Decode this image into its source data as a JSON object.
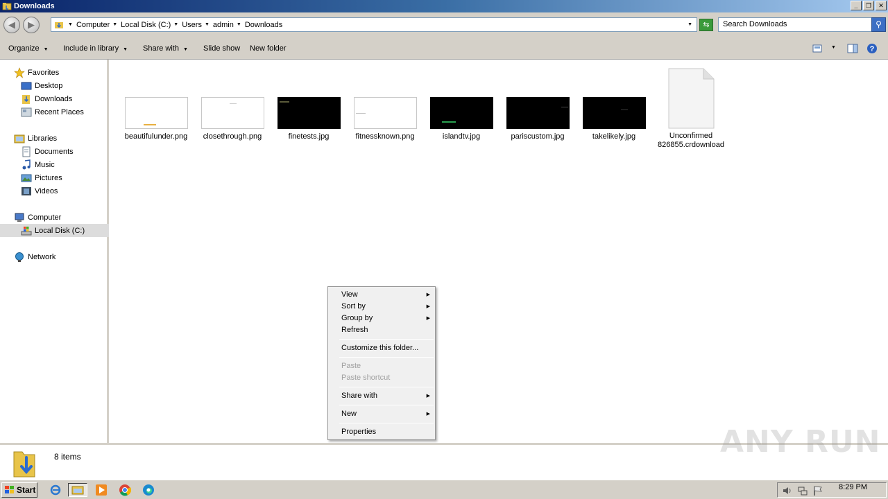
{
  "window": {
    "title": "Downloads",
    "buttons": [
      "minimize",
      "restore",
      "close"
    ]
  },
  "address": {
    "crumbs": [
      "Computer",
      "Local Disk (C:)",
      "Users",
      "admin",
      "Downloads"
    ],
    "search_placeholder": "Search Downloads"
  },
  "toolbar": {
    "organize": "Organize",
    "include_in_library": "Include in library",
    "share_with": "Share with",
    "slide_show": "Slide show",
    "new_folder": "New folder"
  },
  "nav": {
    "favorites": "Favorites",
    "desktop": "Desktop",
    "downloads": "Downloads",
    "recent_places": "Recent Places",
    "libraries": "Libraries",
    "documents": "Documents",
    "music": "Music",
    "pictures": "Pictures",
    "videos": "Videos",
    "computer": "Computer",
    "local_disk": "Local Disk (C:)",
    "network": "Network"
  },
  "files": [
    {
      "name": "beautifulunder.png",
      "thumb": "light"
    },
    {
      "name": "closethrough.png",
      "thumb": "light"
    },
    {
      "name": "finetests.jpg",
      "thumb": "dark"
    },
    {
      "name": "fitnessknown.png",
      "thumb": "light"
    },
    {
      "name": "islandtv.jpg",
      "thumb": "dark"
    },
    {
      "name": "pariscustom.jpg",
      "thumb": "dark"
    },
    {
      "name": "takelikely.jpg",
      "thumb": "dark"
    },
    {
      "name_line1": "Unconfirmed",
      "name_line2": "826855.crdownload",
      "thumb": "document"
    }
  ],
  "context_menu": {
    "view": "View",
    "sort_by": "Sort by",
    "group_by": "Group by",
    "refresh": "Refresh",
    "customize": "Customize this folder...",
    "paste": "Paste",
    "paste_shortcut": "Paste shortcut",
    "share_with": "Share with",
    "new": "New",
    "properties": "Properties"
  },
  "status": {
    "item_count": "8 items",
    "watermark": "ANY RUN"
  },
  "taskbar": {
    "start": "Start",
    "clock": "8:29 PM"
  }
}
